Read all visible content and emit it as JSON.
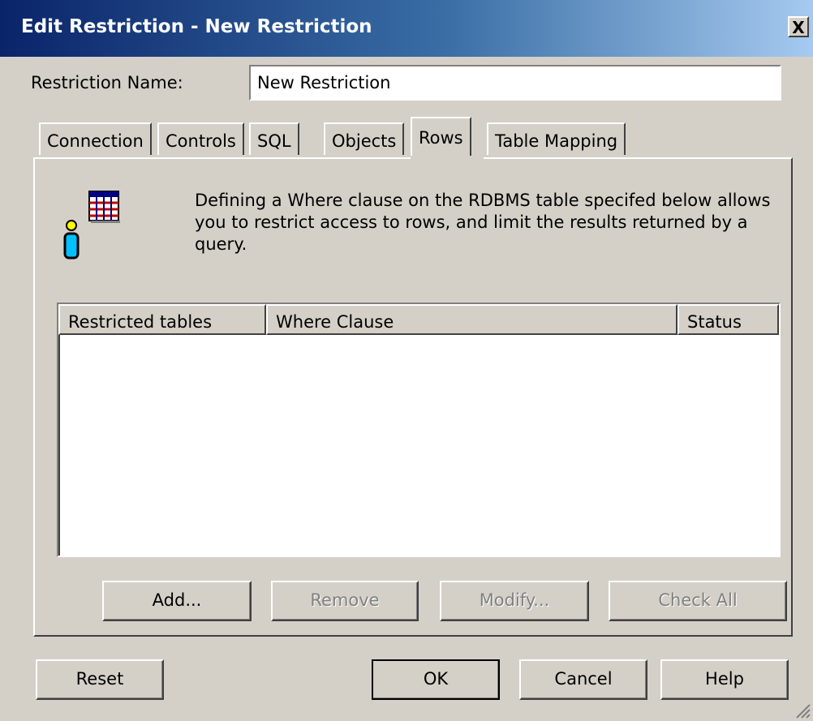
{
  "window": {
    "title": "Edit Restriction - New Restriction",
    "close_label": "X"
  },
  "restriction_name": {
    "label": "Restriction Name:",
    "value": "New Restriction"
  },
  "tabs": [
    {
      "label": "Connection"
    },
    {
      "label": "Controls"
    },
    {
      "label": "SQL"
    },
    {
      "label": "Objects"
    },
    {
      "label": "Rows",
      "active": true
    },
    {
      "label": "Table Mapping"
    }
  ],
  "rows_tab": {
    "description": "Defining a Where clause on the RDBMS table specifed below allows you to restrict access to rows, and limit the results returned by a query.",
    "columns": [
      "Restricted tables",
      "Where Clause",
      "Status"
    ],
    "rows": [],
    "buttons": {
      "add": "Add...",
      "remove": "Remove",
      "modify": "Modify...",
      "check_all": "Check All"
    }
  },
  "footer": {
    "reset": "Reset",
    "ok": "OK",
    "cancel": "Cancel",
    "help": "Help"
  },
  "icons": {
    "rows_icon": "table-with-user-icon",
    "close": "close-icon",
    "grip": "resize-grip-icon"
  }
}
